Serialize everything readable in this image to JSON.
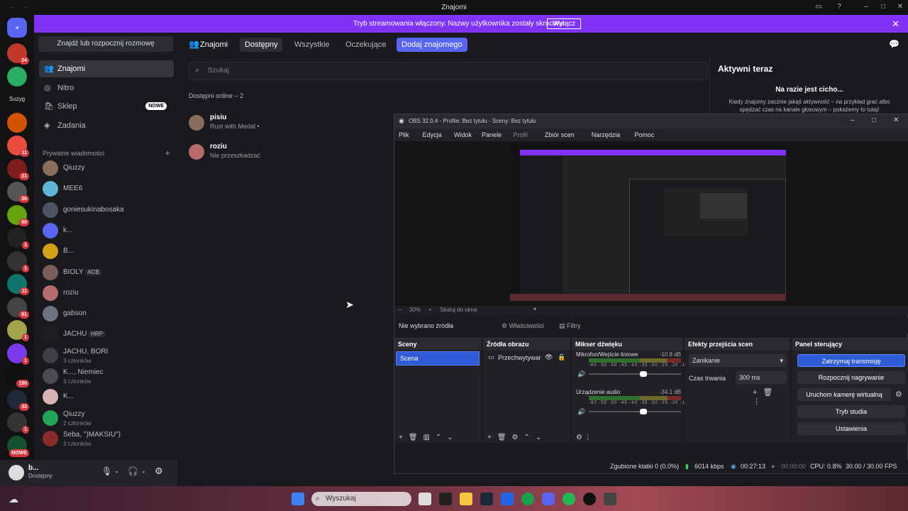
{
  "window": {
    "title": "Znajomi"
  },
  "banner": {
    "message": "Tryb streamowania włączony. Nazwy użytkownika zostały skrócone.",
    "button": "Wyłącz"
  },
  "guilds": [
    {
      "badge": "24",
      "color": "#c0392b"
    },
    {
      "badge": "",
      "color": "#27ae60"
    },
    {
      "badge": "",
      "label": "Suzyg",
      "color": "#121214"
    },
    {
      "badge": "",
      "color": "#d35400"
    },
    {
      "badge": "11",
      "color": "#e74c3c"
    },
    {
      "badge": "21",
      "color": "#7f1d1d"
    },
    {
      "badge": "26",
      "color": "#555"
    },
    {
      "badge": "60",
      "color": "#65a30d"
    },
    {
      "badge": "1",
      "color": "#222"
    },
    {
      "badge": "1",
      "color": "#333"
    },
    {
      "badge": "11",
      "color": "#0f766e"
    },
    {
      "badge": "61",
      "color": "#444"
    },
    {
      "badge": "1",
      "color": "#a3a34a"
    },
    {
      "badge": "1",
      "color": "#7c3aed"
    },
    {
      "badge": "150",
      "color": "#111"
    },
    {
      "badge": "33",
      "color": "#1f2937"
    },
    {
      "badge": "1",
      "color": "#333"
    },
    {
      "badge": "NOWE",
      "color": "#14532d"
    }
  ],
  "dm": {
    "search": "Znajdź lub rozpocznij rozmowę",
    "nav": [
      {
        "label": "Znajomi",
        "icon": "friends-icon"
      },
      {
        "label": "Nitro",
        "icon": "nitro-icon"
      },
      {
        "label": "Sklep",
        "icon": "shop-icon",
        "badge": "NOWE"
      },
      {
        "label": "Zadania",
        "icon": "quests-icon"
      }
    ],
    "private_header": "Prywatne wiadomości",
    "list": [
      {
        "name": "Qiuzzy",
        "sub": "",
        "color": "#8a6d5a"
      },
      {
        "name": "MEE6",
        "sub": "",
        "color": "#5fb4d8"
      },
      {
        "name": "goniesukinabosaka",
        "sub": "",
        "color": "#4b5563"
      },
      {
        "name": "k...",
        "sub": "",
        "color": "#5865f2"
      },
      {
        "name": "B...",
        "sub": "",
        "color": "#d4a017"
      },
      {
        "name": "BIOLY",
        "tag": "ACB",
        "sub": "",
        "color": "#7b5e57"
      },
      {
        "name": "roziu",
        "sub": "",
        "color": "#b86b6b"
      },
      {
        "name": "gabson",
        "sub": "",
        "color": "#6b7280"
      },
      {
        "name": "JACHU",
        "tag": "HRP",
        "sub": "",
        "color": "#1f1f1f"
      },
      {
        "name": "JACHU, BORI",
        "sub": "3 członków",
        "color": "#3f3f46"
      },
      {
        "name": "K..., Niemiec",
        "sub": "3 członków",
        "color": "#4b4b55"
      },
      {
        "name": "K...",
        "sub": "",
        "color": "#d9b3b3"
      },
      {
        "name": "Qiuzzy",
        "sub": "2 członków",
        "color": "#23a559"
      },
      {
        "name": "Seba, \")MAKSIU\")",
        "sub": "3 członków",
        "color": "#8b2c2c"
      }
    ]
  },
  "user": {
    "name": "b...",
    "status": "Dostępny"
  },
  "friends": {
    "tabs": {
      "title": "Znajomi",
      "online": "Dostępny",
      "all": "Wszystkie",
      "pending": "Oczekujące",
      "add": "Dodaj znajomego"
    },
    "search_placeholder": "Szukaj",
    "online_header": "Dostępni online – 2",
    "list": [
      {
        "name": "pisiu",
        "status": "Rust with Medal •"
      },
      {
        "name": "roziu",
        "status": "Nie przeszkadzać"
      }
    ],
    "active": {
      "title": "Aktywni teraz",
      "empty_title": "Na razie jest cicho...",
      "empty_text": "Kiedy znajomy zacznie jakąś aktywność – na przykład grać albo spędzać czas na kanale głosowym – pokażemy to tutaj!"
    }
  },
  "obs": {
    "title": "OBS 32.0.4 - Profile: Bez tytułu - Sceny: Bez tytułu",
    "menu": [
      "Plik",
      "Edycja",
      "Widok",
      "Panele",
      "Profil",
      "Zbiór scen",
      "Narzędzia",
      "Pomoc"
    ],
    "zoom": "30%",
    "zoom_fit": "Skaluj do okna",
    "no_source": "Nie wybrano źródła",
    "properties": "Właściwości",
    "filters": "Filtry",
    "docks": {
      "scenes": "Sceny",
      "sources": "Źródła obrazu",
      "mixer": "Mikser dźwięku",
      "transitions": "Efekty przejścia scen",
      "controls": "Panel sterujący"
    },
    "scene": "Scena",
    "source": "Przechwytywar",
    "mixer": [
      {
        "name": "Mikrofon/Wejście liniowe",
        "db": "-10.8 dB",
        "level": 0.55
      },
      {
        "name": "Urządzenie audio",
        "db": "-34.1 dB",
        "level": 0.55
      }
    ],
    "transition": "Zanikanie",
    "duration_label": "Czas trwania",
    "duration": "300 ms",
    "controls": [
      "Zatrzymaj transmisję",
      "Rozpocznij nagrywanie",
      "Uruchom kamerę wirtualną",
      "Tryb studia",
      "Ustawienia"
    ],
    "status": {
      "dropped": "Zgubione klatki 0 (0.0%)",
      "kbps": "6014 kbps",
      "stream_time": "00:27:13",
      "rec_time": "00:00:00",
      "cpu": "CPU: 0.8%",
      "fps": "30.00 / 30.00 FPS"
    }
  },
  "taskbar": {
    "search": "Wyszukaj"
  }
}
